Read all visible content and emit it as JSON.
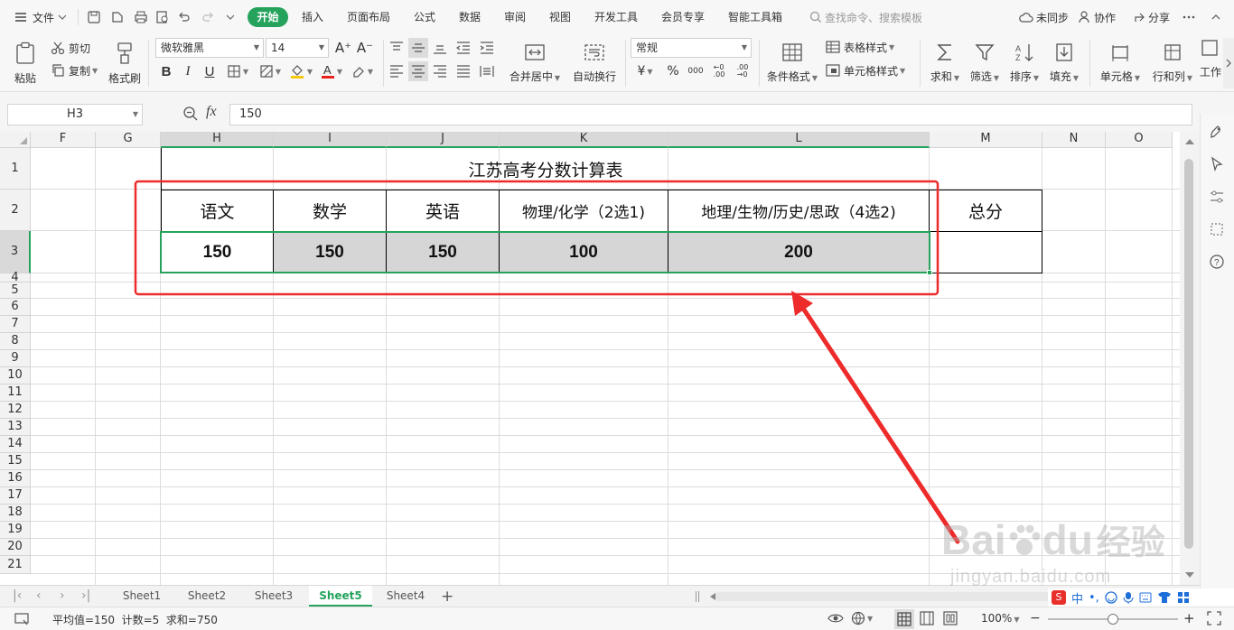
{
  "menubar": {
    "file_label": "文件",
    "tabs": [
      {
        "label": "开始",
        "active": true
      },
      {
        "label": "插入"
      },
      {
        "label": "页面布局"
      },
      {
        "label": "公式"
      },
      {
        "label": "数据"
      },
      {
        "label": "审阅"
      },
      {
        "label": "视图"
      },
      {
        "label": "开发工具"
      },
      {
        "label": "会员专享"
      },
      {
        "label": "智能工具箱"
      }
    ],
    "search_placeholder": "查找命令、搜索模板",
    "sync_label": "未同步",
    "collab_label": "协作",
    "share_label": "分享"
  },
  "ribbon": {
    "paste": "粘贴",
    "cut": "剪切",
    "copy": "复制",
    "format_painter": "格式刷",
    "font_name": "微软雅黑",
    "font_size": "14",
    "merge_center": "合并居中",
    "wrap_text": "自动换行",
    "number_format": "常规",
    "conditional_format": "条件格式",
    "table_style": "表格样式",
    "cell_style": "单元格样式",
    "sum": "求和",
    "filter": "筛选",
    "sort": "排序",
    "fill": "填充",
    "cell": "单元格",
    "row_col": "行和列",
    "worksheet": "工作"
  },
  "formula_bar": {
    "name_box": "H3",
    "formula": "150"
  },
  "grid": {
    "columns": [
      {
        "label": "F"
      },
      {
        "label": "G"
      },
      {
        "label": "H",
        "selected": true
      },
      {
        "label": "I",
        "selected": true
      },
      {
        "label": "J",
        "selected": true
      },
      {
        "label": "K",
        "selected": true
      },
      {
        "label": "L",
        "selected": true
      },
      {
        "label": "M"
      },
      {
        "label": "N"
      },
      {
        "label": "O"
      }
    ],
    "rows": [
      "1",
      "2",
      "3",
      "4",
      "5",
      "6",
      "7",
      "8",
      "9",
      "10",
      "11",
      "12",
      "13",
      "14",
      "15",
      "16",
      "17",
      "18",
      "19",
      "20",
      "21"
    ],
    "title": "江苏高考分数计算表",
    "headers": [
      "语文",
      "数学",
      "英语",
      "物理/化学（2选1)",
      "地理/生物/历史/思政（4选2)",
      "总分"
    ],
    "values": [
      "150",
      "150",
      "150",
      "100",
      "200",
      ""
    ]
  },
  "sheets": [
    {
      "label": "Sheet1"
    },
    {
      "label": "Sheet2"
    },
    {
      "label": "Sheet3"
    },
    {
      "label": "Sheet5",
      "active": true
    },
    {
      "label": "Sheet4"
    }
  ],
  "status": {
    "summary": "平均值=150  计数=5  求和=750",
    "zoom": "100%"
  },
  "watermark": {
    "brand": "Bai",
    "brand_suffix": "du",
    "cn": "经验",
    "url": "jingyan.baidu.com"
  },
  "colors": {
    "accent": "#25a35d",
    "annotation": "#ee2b2b",
    "selection_fill": "#d6d6d6"
  }
}
